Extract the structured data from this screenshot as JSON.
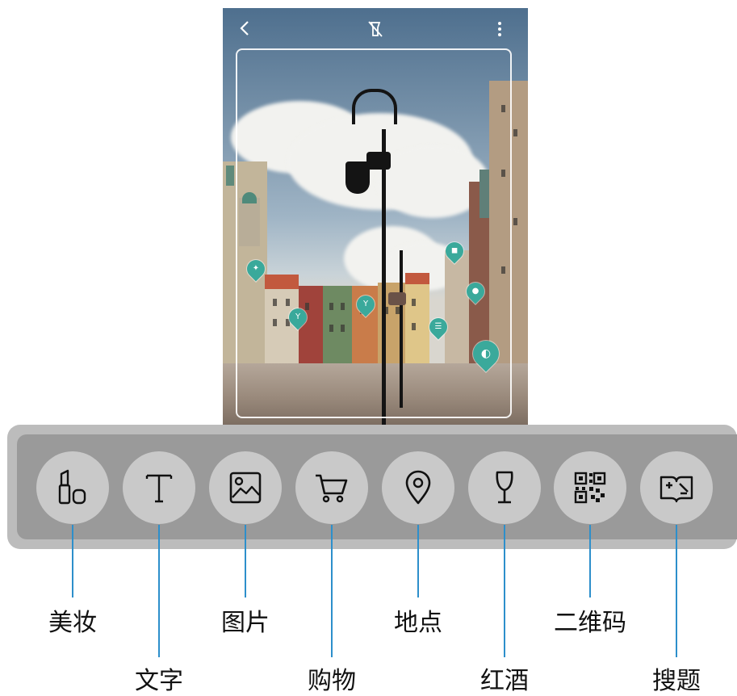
{
  "topbar": {
    "back_icon": "chevron-left-icon",
    "flash_icon": "flash-off-icon",
    "more_icon": "more-vertical-icon"
  },
  "tools": [
    {
      "id": "makeup",
      "icon": "lipstick-icon",
      "label": "美妆"
    },
    {
      "id": "text",
      "icon": "text-icon",
      "label": "文字"
    },
    {
      "id": "image",
      "icon": "image-icon",
      "label": "图片"
    },
    {
      "id": "shopping",
      "icon": "cart-icon",
      "label": "购物"
    },
    {
      "id": "place",
      "icon": "location-pin-icon",
      "label": "地点"
    },
    {
      "id": "wine",
      "icon": "wine-glass-icon",
      "label": "红酒"
    },
    {
      "id": "qr",
      "icon": "qr-code-icon",
      "label": "二维码"
    },
    {
      "id": "search",
      "icon": "search-question-icon",
      "label": "搜题"
    }
  ],
  "colors": {
    "leader_line": "#2d8fcb",
    "pin": "#3aa99b",
    "bar_outer": "#bcbcbc",
    "bar_inner": "#9a9a9a",
    "tool_circle": "#c9c9c9"
  }
}
